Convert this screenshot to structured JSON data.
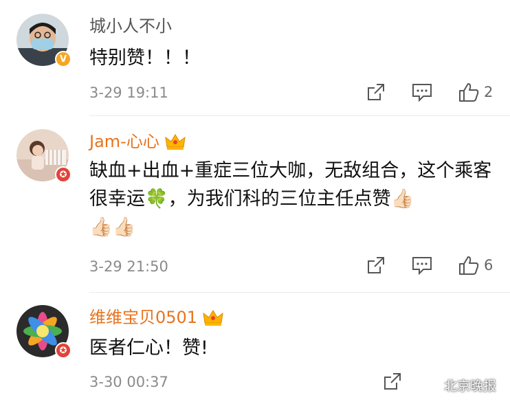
{
  "comments": [
    {
      "user": "城小人不小",
      "text": "特别赞！！！",
      "time": "3-29 19:11",
      "likes": "2",
      "badge": "V",
      "vip": false
    },
    {
      "user": "Jam-心心",
      "text": "缺血+出血+重症三位大咖，无敌组合，这个乘客很幸运🍀，为我们科的三位主任点赞👍🏻\n👍🏻👍🏻",
      "time": "3-29 21:50",
      "likes": "6",
      "badge": "✪",
      "vip": true
    },
    {
      "user": "维维宝贝0501",
      "text": "医者仁心！赞!",
      "time": "3-30 00:37",
      "likes": "",
      "badge": "✪",
      "vip": true
    }
  ],
  "watermark": "北京晚报",
  "colors": {
    "vip_name": "#e8731d",
    "normal_name": "#555555",
    "badge_gold": "#f5a623",
    "badge_red": "#e0443a"
  },
  "icons": [
    "share-icon",
    "comment-icon",
    "like-icon",
    "crown-icon",
    "wechat-icon"
  ]
}
